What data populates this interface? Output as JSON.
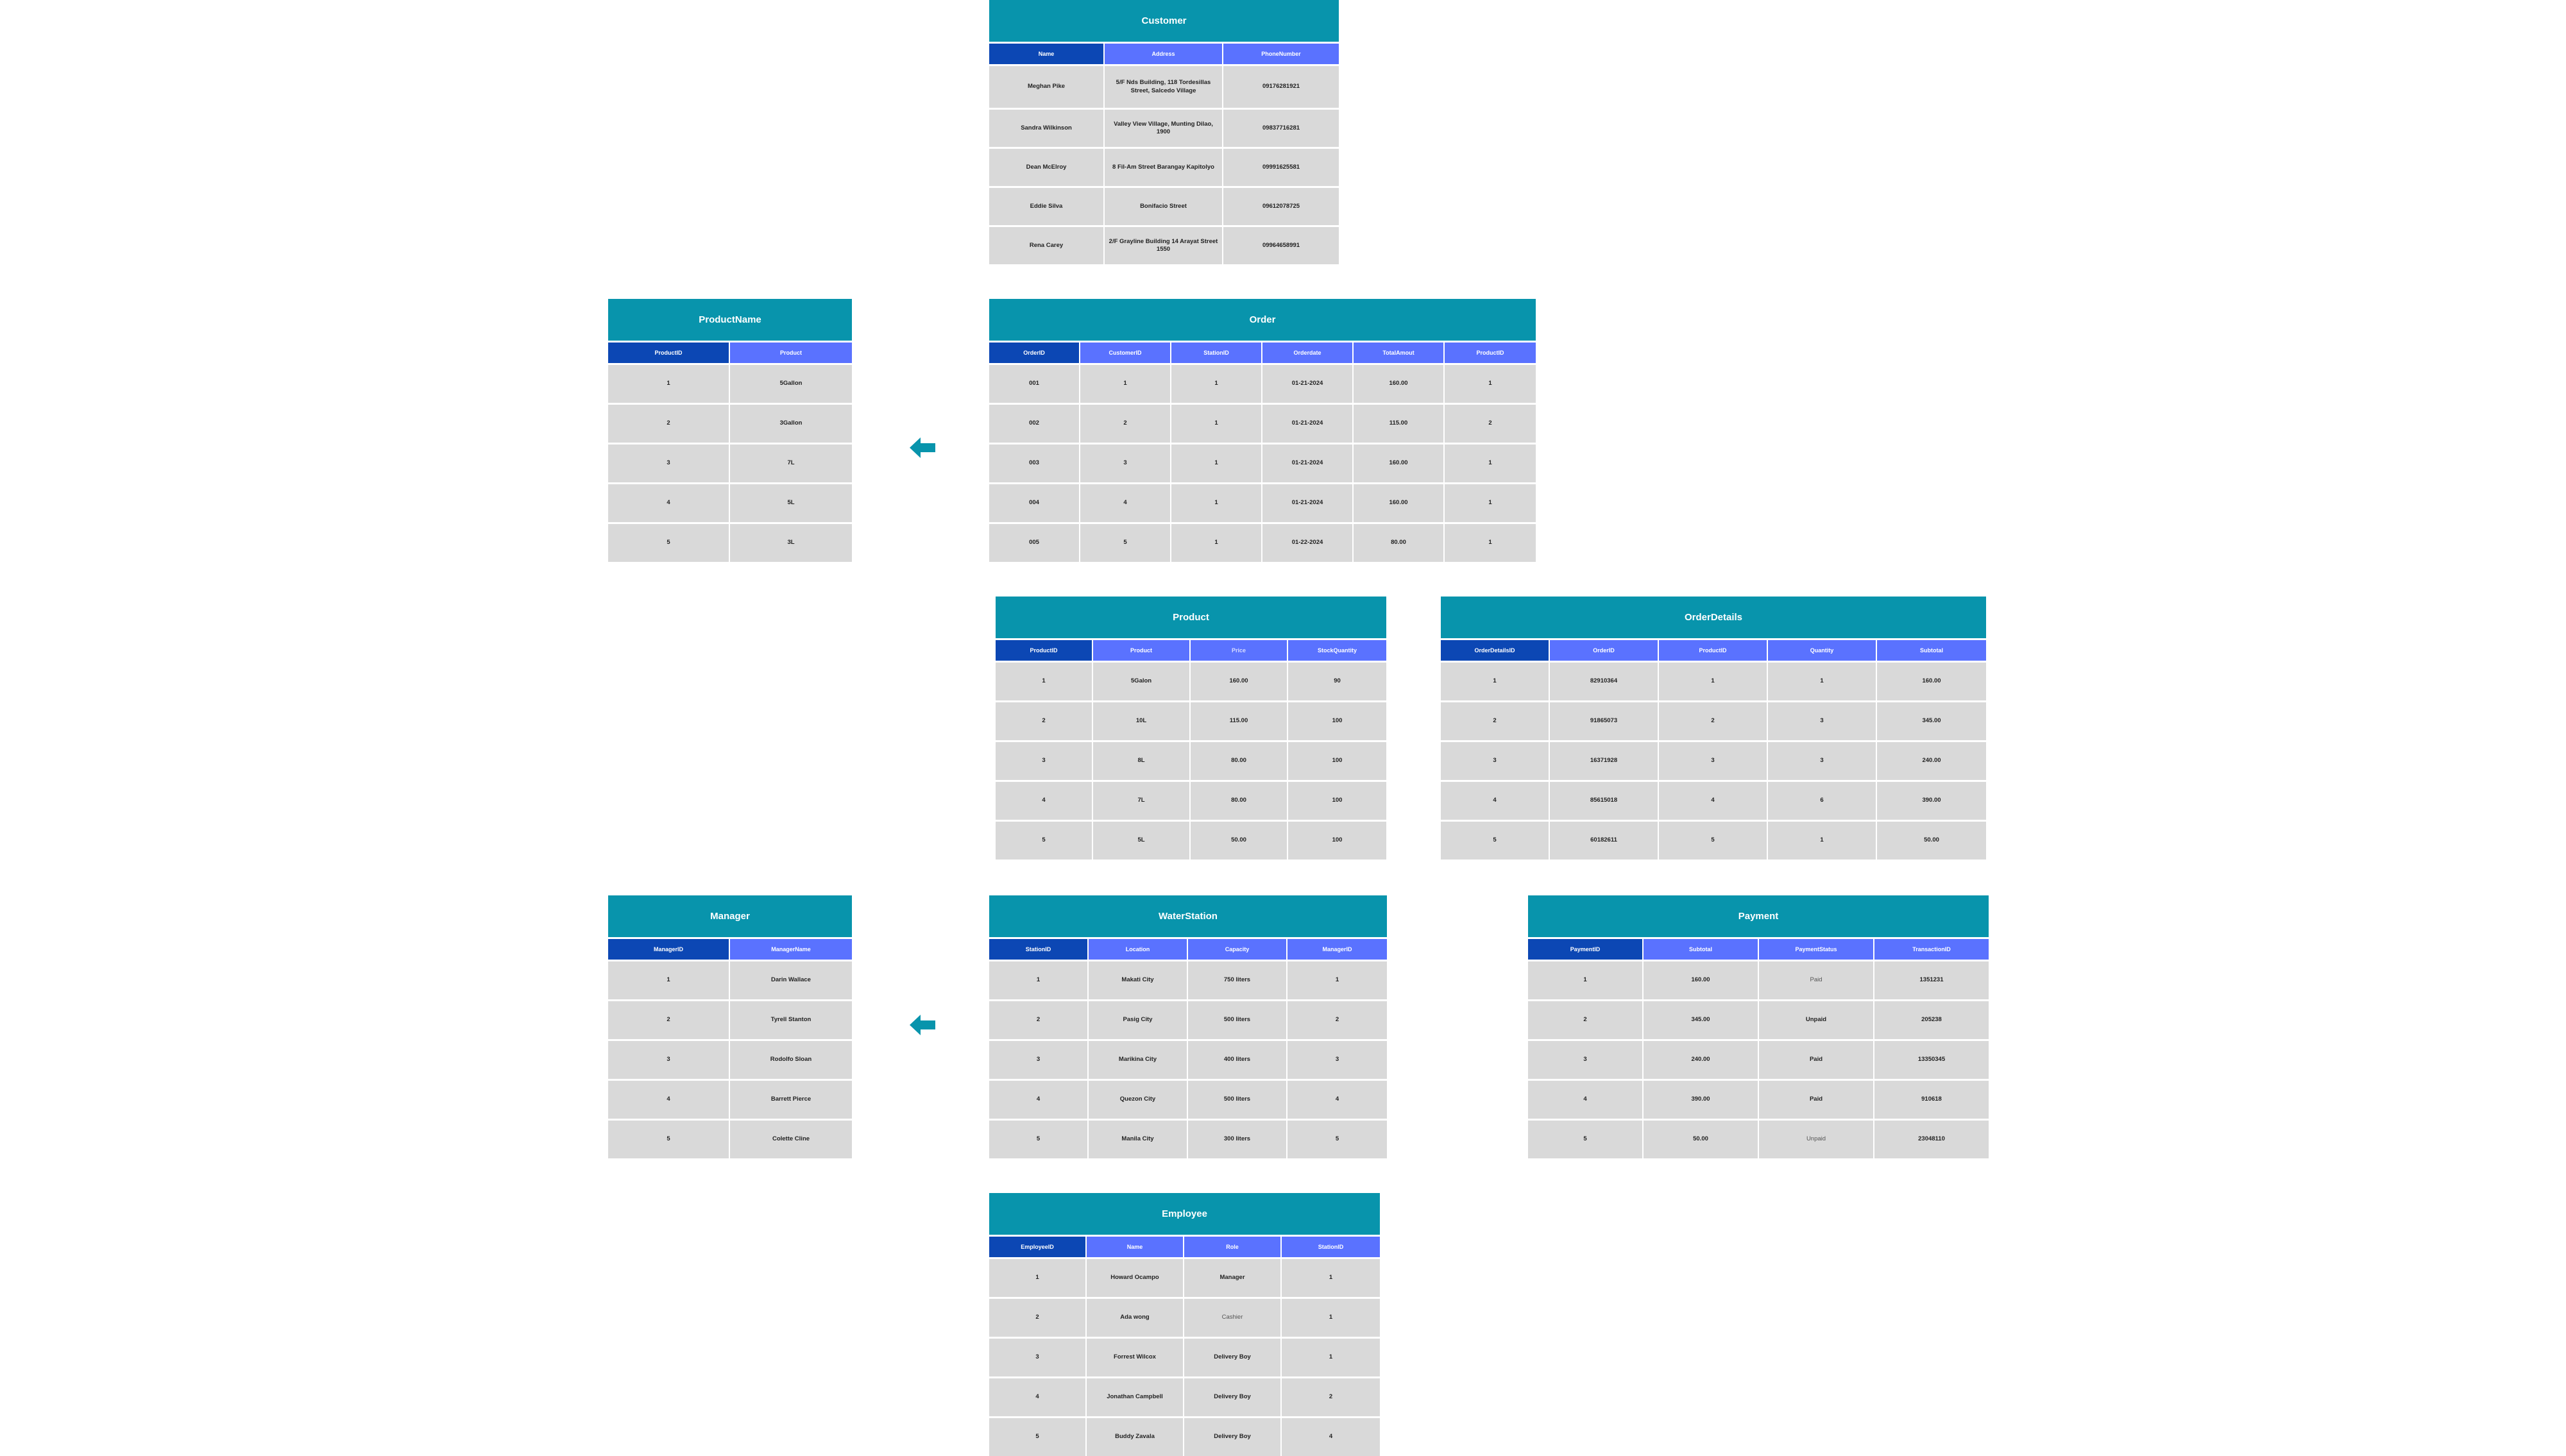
{
  "colors": {
    "title_bg": "#0894ac",
    "header_first": "#0c47b4",
    "header_other": "#5a72ff",
    "cell_bg": "#d9d9d9",
    "arrow": "#0894ac"
  },
  "icons": {
    "relation_arrow": "arrow-left-icon"
  },
  "tables": {
    "customer": {
      "title": "Customer",
      "headers": [
        "Name",
        "Address",
        "PhoneNumber"
      ],
      "rows": [
        [
          "Meghan Pike",
          "5/F Nds Building, 118 Tordesillas Street, Salcedo Village",
          "09176281921"
        ],
        [
          "Sandra Wilkinson",
          "Valley View Village, Munting Dilao, 1900",
          "09837716281"
        ],
        [
          "Dean McElroy",
          "8 Fil-Am Street Barangay Kapitolyo",
          "09991625581"
        ],
        [
          "Eddie Silva",
          "Bonifacio Street",
          "09612078725"
        ],
        [
          "Rena Carey",
          "2/F Grayline Building 14 Arayat Street 1550",
          "09964658991"
        ]
      ]
    },
    "productname": {
      "title": "ProductName",
      "headers": [
        "ProductID",
        "Product"
      ],
      "rows": [
        [
          "1",
          "5Gallon"
        ],
        [
          "2",
          "3Gallon"
        ],
        [
          "3",
          "7L"
        ],
        [
          "4",
          "5L"
        ],
        [
          "5",
          "3L"
        ]
      ]
    },
    "order": {
      "title": "Order",
      "headers": [
        "OrderID",
        "CustomerID",
        "StationID",
        "Orderdate",
        "TotalAmout",
        "ProductID"
      ],
      "rows": [
        [
          "001",
          "1",
          "1",
          "01-21-2024",
          "160.00",
          "1"
        ],
        [
          "002",
          "2",
          "1",
          "01-21-2024",
          "115.00",
          "2"
        ],
        [
          "003",
          "3",
          "1",
          "01-21-2024",
          "160.00",
          "1"
        ],
        [
          "004",
          "4",
          "1",
          "01-21-2024",
          "160.00",
          "1"
        ],
        [
          "005",
          "5",
          "1",
          "01-22-2024",
          "80.00",
          "1"
        ]
      ]
    },
    "product": {
      "title": "Product",
      "headers": [
        "ProductID",
        "Product",
        "Price",
        "StockQuantity"
      ],
      "rows": [
        [
          "1",
          "5Galon",
          "160.00",
          "90"
        ],
        [
          "2",
          "10L",
          "115.00",
          "100"
        ],
        [
          "3",
          "8L",
          "80.00",
          "100"
        ],
        [
          "4",
          "7L",
          "80.00",
          "100"
        ],
        [
          "5",
          "5L",
          "50.00",
          "100"
        ]
      ]
    },
    "orderdetails": {
      "title": "OrderDetails",
      "headers": [
        "OrderDetailsID",
        "OrderID",
        "ProductID",
        "Quantity",
        "Subtotal"
      ],
      "rows": [
        [
          "1",
          "82910364",
          "1",
          "1",
          "160.00"
        ],
        [
          "2",
          "91865073",
          "2",
          "3",
          "345.00"
        ],
        [
          "3",
          "16371928",
          "3",
          "3",
          "240.00"
        ],
        [
          "4",
          "85615018",
          "4",
          "6",
          "390.00"
        ],
        [
          "5",
          "60182611",
          "5",
          "1",
          "50.00"
        ]
      ]
    },
    "manager": {
      "title": "Manager",
      "headers": [
        "ManagerID",
        "ManagerName"
      ],
      "rows": [
        [
          "1",
          "Darin Wallace"
        ],
        [
          "2",
          "Tyrell Stanton"
        ],
        [
          "3",
          "Rodolfo Sloan"
        ],
        [
          "4",
          "Barrett Pierce"
        ],
        [
          "5",
          "Colette Cline"
        ]
      ]
    },
    "waterstation": {
      "title": "WaterStation",
      "headers": [
        "StationID",
        "Location",
        "Capacity",
        "ManagerID"
      ],
      "rows": [
        [
          "1",
          "Makati City",
          "750 liters",
          "1"
        ],
        [
          "2",
          "Pasig City",
          "500 liters",
          "2"
        ],
        [
          "3",
          "Marikina City",
          "400 liters",
          "3"
        ],
        [
          "4",
          "Quezon City",
          "500 liters",
          "4"
        ],
        [
          "5",
          "Manila City",
          "300 liters",
          "5"
        ]
      ]
    },
    "payment": {
      "title": "Payment",
      "headers": [
        "PaymentID",
        "Subtotal",
        "PaymentStatus",
        "TransactionID"
      ],
      "rows": [
        [
          "1",
          "160.00",
          "Paid",
          "1351231"
        ],
        [
          "2",
          "345.00",
          "Unpaid",
          "205238"
        ],
        [
          "3",
          "240.00",
          "Paid",
          "13350345"
        ],
        [
          "4",
          "390.00",
          "Paid",
          "910618"
        ],
        [
          "5",
          "50.00",
          "Unpaid",
          "23048110"
        ]
      ]
    },
    "employee": {
      "title": "Employee",
      "headers": [
        "EmployeeID",
        "Name",
        "Role",
        "StationID"
      ],
      "rows": [
        [
          "1",
          "Howard Ocampo",
          "Manager",
          "1"
        ],
        [
          "2",
          "Ada wong",
          "Cashier",
          "1"
        ],
        [
          "3",
          "Forrest Wilcox",
          "Delivery Boy",
          "1"
        ],
        [
          "4",
          "Jonathan Campbell",
          "Delivery Boy",
          "2"
        ],
        [
          "5",
          "Buddy Zavala",
          "Delivery Boy",
          "4"
        ]
      ]
    }
  }
}
